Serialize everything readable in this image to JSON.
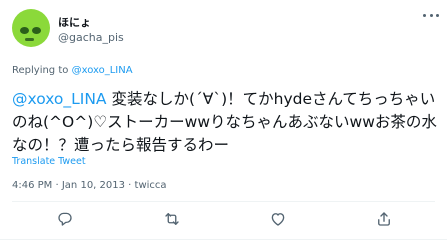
{
  "user": {
    "display_name": "ほにょ",
    "handle": "@gacha_pis"
  },
  "reply": {
    "prefix": "Replying to",
    "to": "@xoxo_LINA"
  },
  "tweet": {
    "mention": "@xoxo_LINA",
    "text": " 変装なしか(´∀`)！てかhydeさんてちっちゃいのね(^O^)♡ストーカーwwりなちゃんあぶないwwお茶の水なの！？遭ったら報告するわー",
    "translate_label": "Translate Tweet"
  },
  "meta": {
    "time": "4:46 PM",
    "date": "Jan 10, 2013",
    "separator": "·",
    "source": "twicca"
  },
  "icons": {
    "avatar": "avatar-green-character",
    "more": "more-options-icon",
    "reply": "reply-icon",
    "retweet": "retweet-icon",
    "like": "like-icon",
    "share": "share-icon"
  },
  "colors": {
    "accent": "#1d9bf0",
    "secondary_text": "#536471",
    "primary_text": "#0f1419",
    "avatar_green": "#8bd93a"
  }
}
